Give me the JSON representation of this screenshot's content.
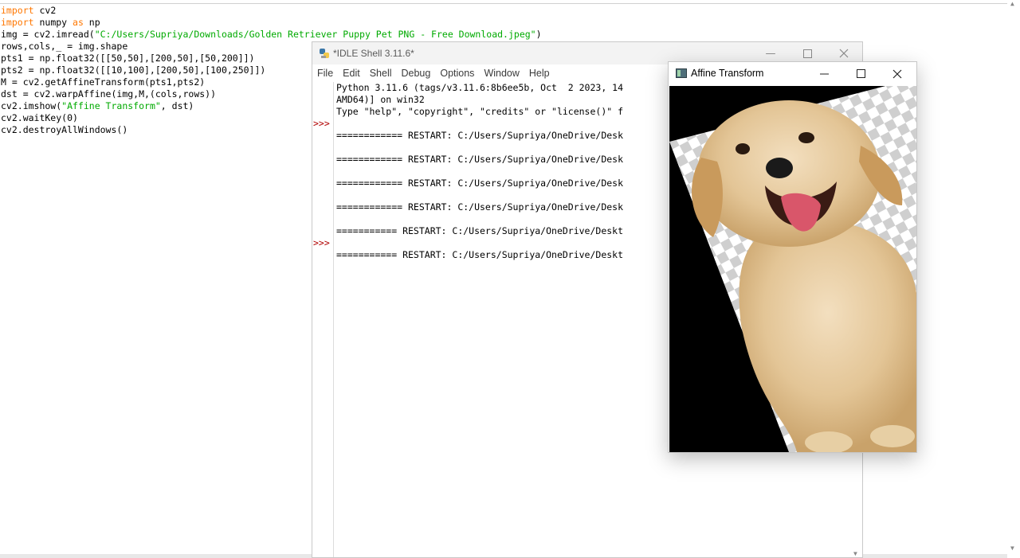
{
  "editor": {
    "lines": [
      [
        {
          "t": "import",
          "c": "kw"
        },
        {
          "t": " cv2"
        }
      ],
      [
        {
          "t": "import",
          "c": "kw"
        },
        {
          "t": " numpy "
        },
        {
          "t": "as",
          "c": "kw"
        },
        {
          "t": " np"
        }
      ],
      [
        {
          "t": "img = cv2.imread("
        },
        {
          "t": "\"C:/Users/Supriya/Downloads/Golden Retriever Puppy Pet PNG - Free Download.jpeg\"",
          "c": "str"
        },
        {
          "t": ")"
        }
      ],
      [
        {
          "t": "rows,cols,_ = img.shape"
        }
      ],
      [
        {
          "t": "pts1 = np.float32([[50,50],[200,50],[50,200]])"
        }
      ],
      [
        {
          "t": "pts2 = np.float32([[10,100],[200,50],[100,250]])"
        }
      ],
      [
        {
          "t": "M = cv2.getAffineTransform(pts1,pts2)"
        }
      ],
      [
        {
          "t": "dst = cv2.warpAffine(img,M,(cols,rows))"
        }
      ],
      [
        {
          "t": "cv2.imshow("
        },
        {
          "t": "\"Affine Transform\"",
          "c": "str"
        },
        {
          "t": ", dst)"
        }
      ],
      [
        {
          "t": "cv2.waitKey(0)"
        }
      ],
      [
        {
          "t": "cv2.destroyAllWindows()"
        }
      ]
    ]
  },
  "shell": {
    "title": "*IDLE Shell 3.11.6*",
    "menu": [
      "File",
      "Edit",
      "Shell",
      "Debug",
      "Options",
      "Window",
      "Help"
    ],
    "prompt_symbol": ">>>",
    "output": [
      "Python 3.11.6 (tags/v3.11.6:8b6ee5b, Oct  2 2023, 14",
      "AMD64)] on win32",
      "Type \"help\", \"copyright\", \"credits\" or \"license()\" f",
      "",
      "============ RESTART: C:/Users/Supriya/OneDrive/Desk",
      "",
      "============ RESTART: C:/Users/Supriya/OneDrive/Desk",
      "",
      "============ RESTART: C:/Users/Supriya/OneDrive/Desk",
      "",
      "============ RESTART: C:/Users/Supriya/OneDrive/Desk",
      "",
      "=========== RESTART: C:/Users/Supriya/OneDrive/Deskt",
      "",
      "=========== RESTART: C:/Users/Supriya/OneDrive/Deskt"
    ]
  },
  "affine_window": {
    "title": "Affine Transform"
  },
  "icons": {
    "minimize": "minimize-icon",
    "maximize": "maximize-icon",
    "close": "close-icon"
  }
}
